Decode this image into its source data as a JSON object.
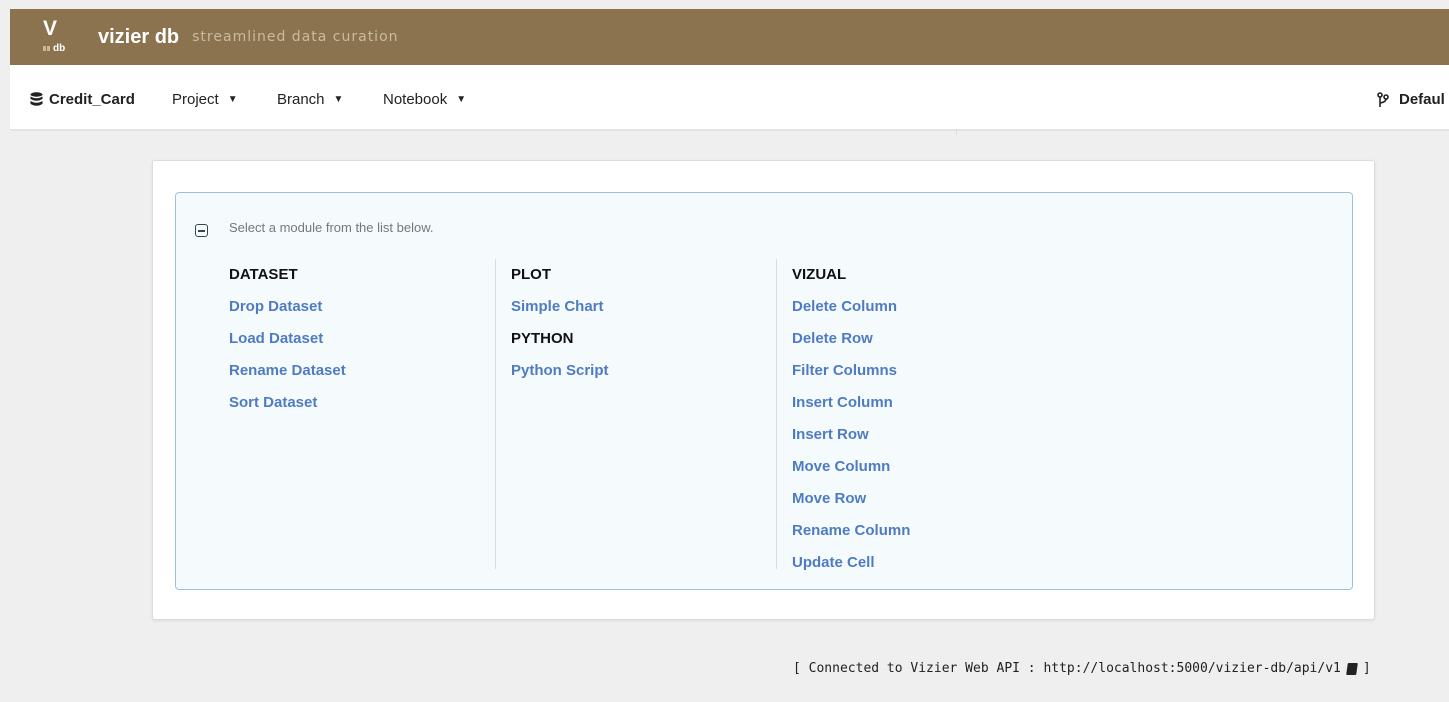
{
  "brand": {
    "logo_letter": "V",
    "logo_sub": "db",
    "title": "vizier db",
    "subtitle": "streamlined data curation"
  },
  "navbar": {
    "project_name": "Credit_Card",
    "menus": [
      "Project",
      "Branch",
      "Notebook"
    ],
    "branch_label": "Defaul"
  },
  "module_picker": {
    "hint": "Select a module from the list below.",
    "columns": [
      {
        "groups": [
          {
            "category": "DATASET",
            "modules": [
              "Drop Dataset",
              "Load Dataset",
              "Rename Dataset",
              "Sort Dataset"
            ]
          }
        ]
      },
      {
        "groups": [
          {
            "category": "PLOT",
            "modules": [
              "Simple Chart"
            ]
          },
          {
            "category": "PYTHON",
            "modules": [
              "Python Script"
            ]
          }
        ]
      },
      {
        "groups": [
          {
            "category": "VIZUAL",
            "modules": [
              "Delete Column",
              "Delete Row",
              "Filter Columns",
              "Insert Column",
              "Insert Row",
              "Move Column",
              "Move Row",
              "Rename Column",
              "Update Cell"
            ]
          }
        ]
      }
    ]
  },
  "footer": {
    "prefix": "[ Connected to Vizier Web API : http://localhost:5000/vizier-db/api/v1",
    "suffix": "]"
  },
  "colors": {
    "banner": "#8b734f",
    "link": "#4f7cc1",
    "panel_border": "#9fc3d6"
  }
}
